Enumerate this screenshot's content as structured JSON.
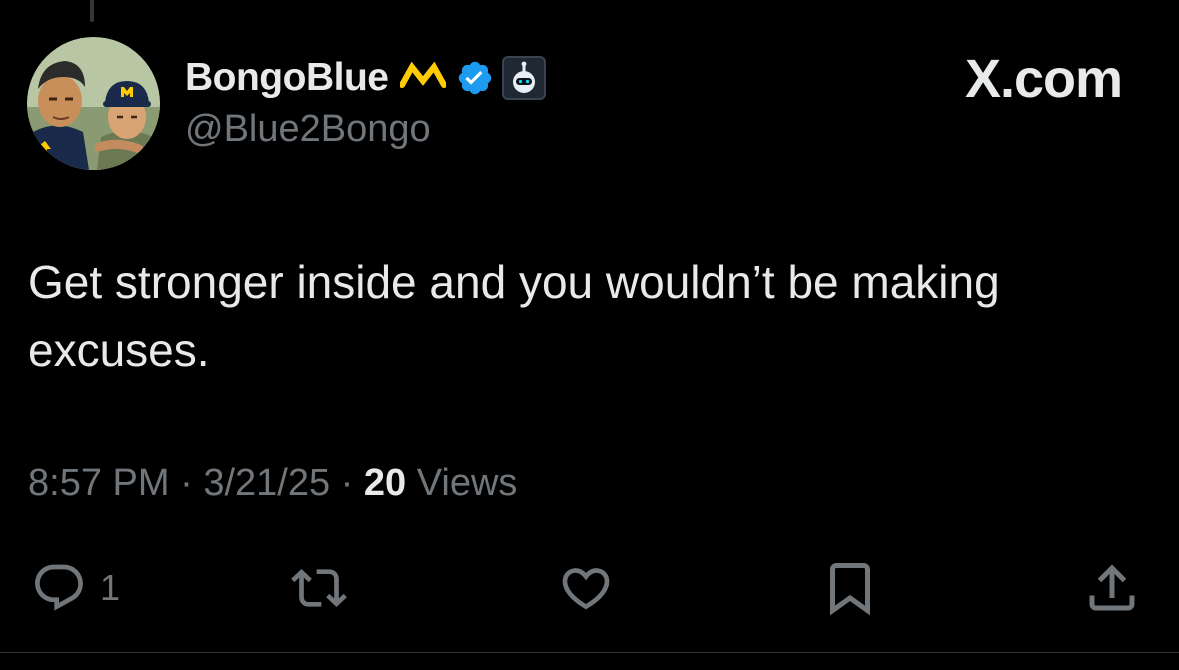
{
  "tweet": {
    "author": {
      "display_name": "BongoBlue",
      "handle": "@Blue2Bongo",
      "avatar_icon": "cartoon-avatar-two-men-michigan-caps",
      "badges": [
        "michigan-m-icon",
        "verified-badge-icon",
        "affiliate-robot-icon"
      ],
      "verified_color": "#1d9bf0",
      "michigan_color": "#ffcb05"
    },
    "site_label": "X.com",
    "text": "Get stronger inside and you wouldn’t be making excuses.",
    "meta": {
      "time": "8:57 PM",
      "separator": "·",
      "date": "3/21/25",
      "views_count": "20",
      "views_label": "Views"
    },
    "actions": {
      "reply": {
        "icon": "reply-icon",
        "count": "1"
      },
      "repost": {
        "icon": "repost-icon"
      },
      "like": {
        "icon": "heart-icon"
      },
      "bookmark": {
        "icon": "bookmark-icon"
      },
      "share": {
        "icon": "share-icon"
      }
    }
  },
  "colors": {
    "background": "#000000",
    "primary_text": "#e7e9ea",
    "secondary_text": "#71767b"
  }
}
